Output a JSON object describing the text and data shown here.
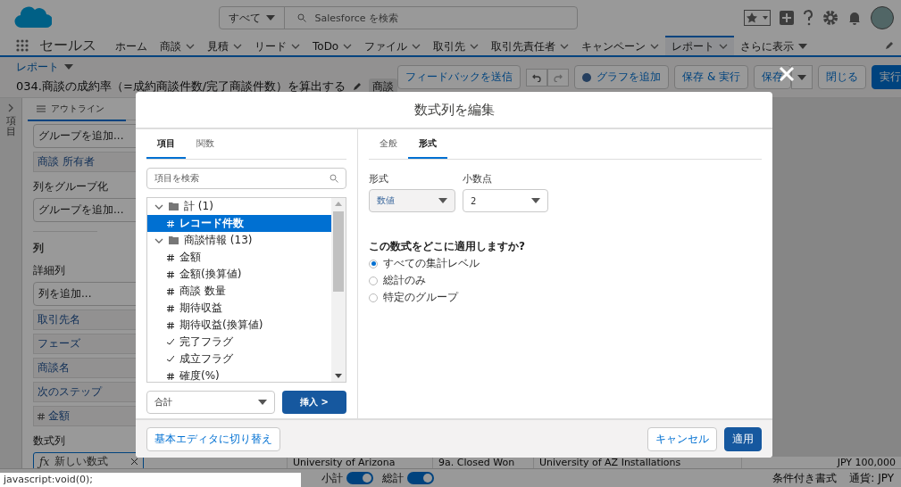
{
  "header": {
    "search_scope": "すべて",
    "search_placeholder": "Salesforce を検索"
  },
  "nav": {
    "app_name": "セールス",
    "items": [
      {
        "label": "ホーム",
        "menu": false,
        "selected": false
      },
      {
        "label": "商談",
        "menu": true,
        "selected": false
      },
      {
        "label": "見積",
        "menu": true,
        "selected": false
      },
      {
        "label": "リード",
        "menu": true,
        "selected": false
      },
      {
        "label": "ToDo",
        "menu": true,
        "selected": false
      },
      {
        "label": "ファイル",
        "menu": true,
        "selected": false
      },
      {
        "label": "取引先",
        "menu": true,
        "selected": false
      },
      {
        "label": "取引先責任者",
        "menu": true,
        "selected": false
      },
      {
        "label": "キャンペーン",
        "menu": true,
        "selected": false
      },
      {
        "label": "レポート",
        "menu": true,
        "selected": true
      }
    ],
    "more": "さらに表示"
  },
  "page_header": {
    "breadcrumb": "レポート",
    "title": "034.商談の成約率（=成約商談件数/完了商談件数）を算出する",
    "badge": "商談",
    "buttons": {
      "feedback": "フィードバックを送信",
      "add_chart": "グラフを追加",
      "save_run": "保存 & 実行",
      "save": "保存",
      "close": "閉じる",
      "run": "実行"
    }
  },
  "sidebar": {
    "label": "項目"
  },
  "outline": {
    "tab": "アウトライン",
    "group_rows_field": "グループを追加...",
    "group_rows": [
      "商談 所有者"
    ],
    "group_columns_label": "列をグループ化",
    "group_columns_field": "グループを追加...",
    "columns_heading": "列",
    "detail_label": "詳細列",
    "add_column_field": "列を追加...",
    "columns": [
      {
        "label": "取引先名",
        "kind": "text"
      },
      {
        "label": "フェーズ",
        "kind": "text"
      },
      {
        "label": "商談名",
        "kind": "text"
      },
      {
        "label": "次のステップ",
        "kind": "text"
      },
      {
        "label": "金額",
        "kind": "number"
      }
    ],
    "formula_label": "数式列",
    "formula_icon": "ƒx",
    "formula_item": "新しい数式"
  },
  "table_row": [
    "University of Arizona",
    "9a. Closed Won",
    "University of AZ Installations",
    "JPY 100,000"
  ],
  "footer": {
    "toggles": [
      {
        "label": "小計",
        "on": true
      },
      {
        "label": "総計",
        "on": true
      }
    ],
    "conditional_format": "条件付き書式",
    "currency": "通貨: JPY"
  },
  "status_url": "javascript:void(0);",
  "modal": {
    "title": "数式列を編集",
    "left_tabs": [
      {
        "label": "項目",
        "selected": true
      },
      {
        "label": "関数",
        "selected": false
      }
    ],
    "search_placeholder": "項目を検索",
    "tree": [
      {
        "label": "計 (1)",
        "expanded": true,
        "children": [
          {
            "label": "レコード件数",
            "kind": "number",
            "selected": true
          }
        ]
      },
      {
        "label": "商談情報 (13)",
        "expanded": true,
        "children": [
          {
            "label": "金額",
            "kind": "number",
            "selected": false
          },
          {
            "label": "金額(換算値)",
            "kind": "number",
            "selected": false
          },
          {
            "label": "商談 数量",
            "kind": "number",
            "selected": false
          },
          {
            "label": "期待収益",
            "kind": "number",
            "selected": false
          },
          {
            "label": "期待収益(換算値)",
            "kind": "number",
            "selected": false
          },
          {
            "label": "完了フラグ",
            "kind": "boolean",
            "selected": false
          },
          {
            "label": "成立フラグ",
            "kind": "boolean",
            "selected": false
          },
          {
            "label": "確度(%)",
            "kind": "number",
            "selected": false
          }
        ]
      }
    ],
    "aggregate": "合計",
    "insert": "挿入 >",
    "right_tabs": [
      {
        "label": "全般",
        "selected": false
      },
      {
        "label": "形式",
        "selected": true
      }
    ],
    "format_label": "形式",
    "format_value": "数値",
    "decimals_label": "小数点",
    "decimals_value": "2",
    "question": "この数式をどこに適用しますか?",
    "options": [
      {
        "label": "すべての集計レベル",
        "selected": true
      },
      {
        "label": "総計のみ",
        "selected": false
      },
      {
        "label": "特定のグループ",
        "selected": false
      }
    ],
    "switch_editor": "基本エディタに切り替え",
    "cancel": "キャンセル",
    "apply": "適用"
  }
}
